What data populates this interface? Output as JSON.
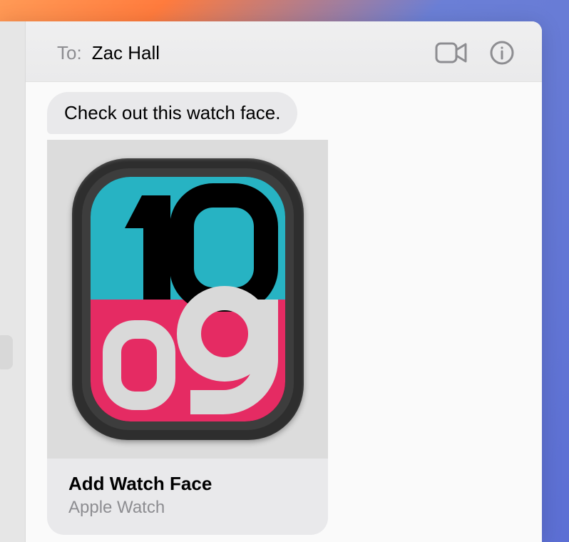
{
  "header": {
    "to_label": "To:",
    "recipient": "Zac Hall"
  },
  "message": {
    "text": "Check out this watch face."
  },
  "attachment": {
    "title": "Add Watch Face",
    "subtitle": "Apple Watch",
    "face": {
      "top_color": "#27b3c3",
      "bottom_color": "#e52b63",
      "hour_text": "10",
      "minute_text": "09"
    }
  },
  "icons": {
    "video": "video-icon",
    "info": "info-icon"
  }
}
